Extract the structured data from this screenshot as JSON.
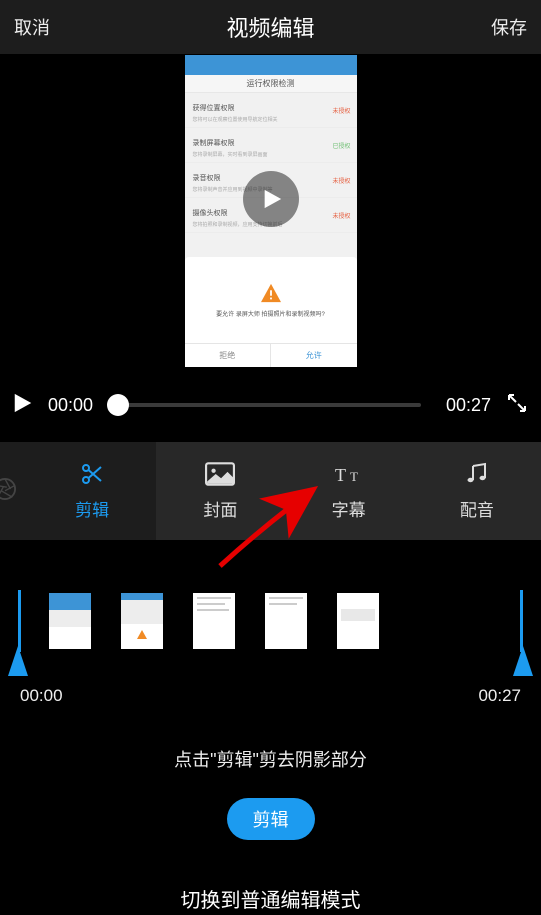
{
  "header": {
    "cancel": "取消",
    "title": "视频编辑",
    "save": "保存"
  },
  "previewed_screen": {
    "status_bar": "运行权限检测",
    "rows": [
      {
        "title": "获得位置权限",
        "sub": "您将可以在观察位置使用导航定位相关",
        "status": "未授权",
        "ok": false
      },
      {
        "title": "录制屏幕权限",
        "sub": "您将录制屏幕，实时看到录屏画面",
        "status": "已授权",
        "ok": true
      },
      {
        "title": "录音权限",
        "sub": "您将录制声音并应用到视频中录制等",
        "status": "未授权",
        "ok": false
      },
      {
        "title": "摄像头权限",
        "sub": "您将拍照和录制视频，应用支持切换前后",
        "status": "未授权",
        "ok": false
      }
    ],
    "dialog": {
      "text": "要允许 录屏大师 拍摄照片和录制视频吗?",
      "deny": "拒绝",
      "allow": "允许"
    }
  },
  "controls": {
    "current": "00:00",
    "total": "00:27"
  },
  "tabs": {
    "edit": "剪辑",
    "cover": "封面",
    "subtitle": "字幕",
    "dub": "配音"
  },
  "timeline": {
    "start": "00:00",
    "end": "00:27"
  },
  "hint": "点击\"剪辑\"剪去阴影部分",
  "edit_button": "剪辑",
  "switch_mode": "切换到普通编辑模式"
}
